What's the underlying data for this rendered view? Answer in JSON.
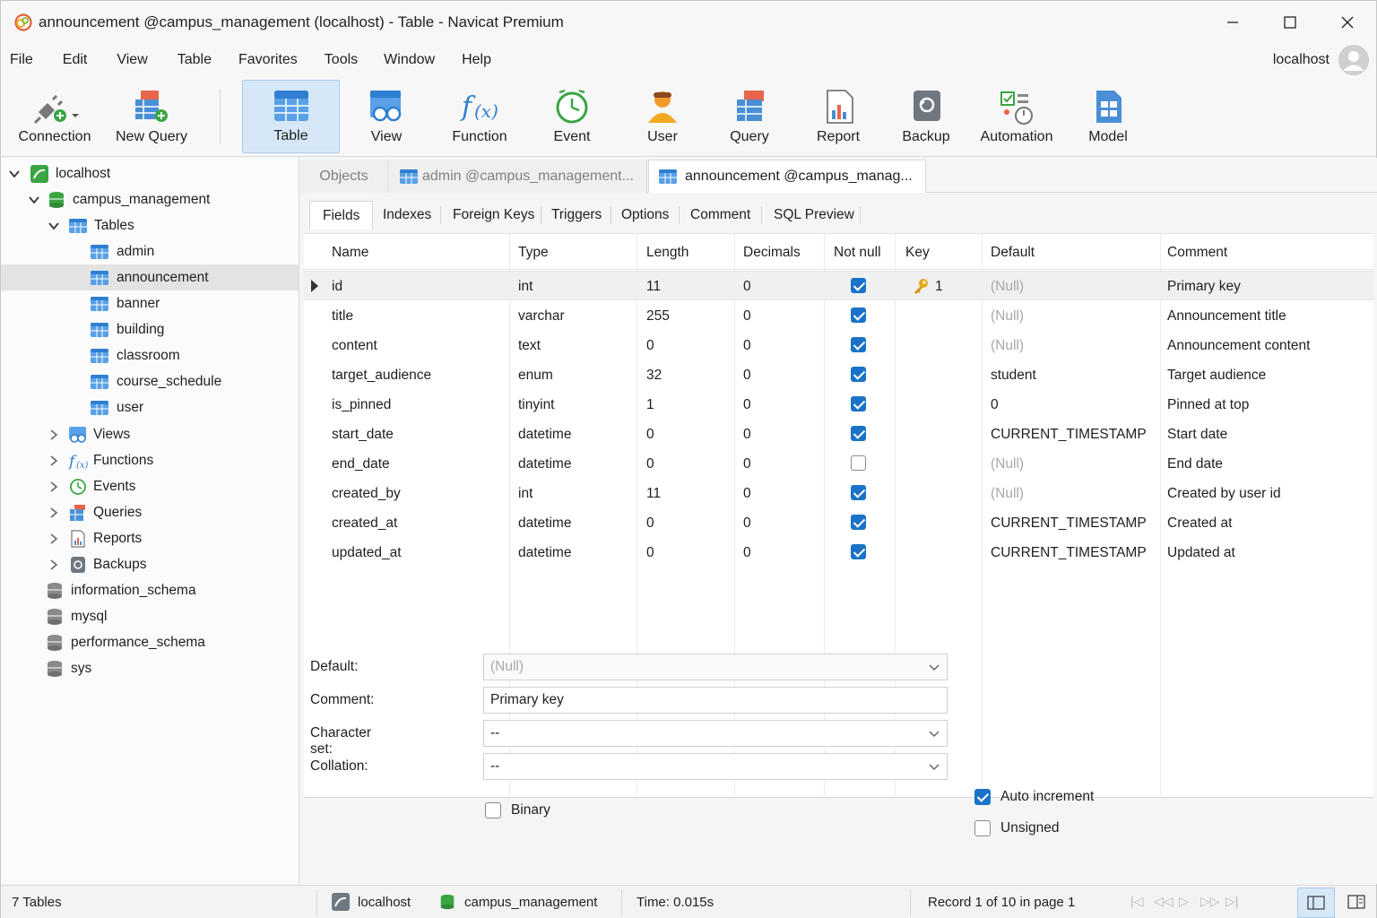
{
  "window": {
    "title": "announcement @campus_management (localhost) - Table - Navicat Premium"
  },
  "menu": [
    "File",
    "Edit",
    "View",
    "Table",
    "Favorites",
    "Tools",
    "Window",
    "Help"
  ],
  "user": {
    "name": "localhost"
  },
  "toolbar": {
    "connection": "Connection",
    "new_query": "New Query",
    "table": "Table",
    "view": "View",
    "function": "Function",
    "event": "Event",
    "user": "User",
    "query": "Query",
    "report": "Report",
    "backup": "Backup",
    "automation": "Automation",
    "model": "Model"
  },
  "sidebar": {
    "connection": "localhost",
    "database": "campus_management",
    "tables_label": "Tables",
    "tables": [
      "admin",
      "announcement",
      "banner",
      "building",
      "classroom",
      "course_schedule",
      "user"
    ],
    "selected_table": "announcement",
    "groups": [
      "Views",
      "Functions",
      "Events",
      "Queries",
      "Reports",
      "Backups"
    ],
    "other_databases": [
      "information_schema",
      "mysql",
      "performance_schema",
      "sys"
    ]
  },
  "doc_tabs": {
    "objects": "Objects",
    "tab1": "admin @campus_management...",
    "tab2": "announcement @campus_manag..."
  },
  "sub_tabs": [
    "Fields",
    "Indexes",
    "Foreign Keys",
    "Triggers",
    "Options",
    "Comment",
    "SQL Preview"
  ],
  "grid": {
    "headers": {
      "name": "Name",
      "type": "Type",
      "length": "Length",
      "decimals": "Decimals",
      "not_null": "Not null",
      "key": "Key",
      "default": "Default",
      "comment": "Comment"
    },
    "rows": [
      {
        "name": "id",
        "type": "int",
        "length": "11",
        "decimals": "0",
        "not_null": true,
        "key": "1",
        "default": "(Null)",
        "comment": "Primary key"
      },
      {
        "name": "title",
        "type": "varchar",
        "length": "255",
        "decimals": "0",
        "not_null": true,
        "key": "",
        "default": "(Null)",
        "comment": "Announcement title"
      },
      {
        "name": "content",
        "type": "text",
        "length": "0",
        "decimals": "0",
        "not_null": true,
        "key": "",
        "default": "(Null)",
        "comment": "Announcement content"
      },
      {
        "name": "target_audience",
        "type": "enum",
        "length": "32",
        "decimals": "0",
        "not_null": true,
        "key": "",
        "default": "student",
        "comment": "Target audience"
      },
      {
        "name": "is_pinned",
        "type": "tinyint",
        "length": "1",
        "decimals": "0",
        "not_null": true,
        "key": "",
        "default": "0",
        "comment": "Pinned at top"
      },
      {
        "name": "start_date",
        "type": "datetime",
        "length": "0",
        "decimals": "0",
        "not_null": true,
        "key": "",
        "default": "CURRENT_TIMESTAMP",
        "comment": "Start date"
      },
      {
        "name": "end_date",
        "type": "datetime",
        "length": "0",
        "decimals": "0",
        "not_null": false,
        "key": "",
        "default": "(Null)",
        "comment": "End date"
      },
      {
        "name": "created_by",
        "type": "int",
        "length": "11",
        "decimals": "0",
        "not_null": true,
        "key": "",
        "default": "(Null)",
        "comment": "Created by user id"
      },
      {
        "name": "created_at",
        "type": "datetime",
        "length": "0",
        "decimals": "0",
        "not_null": true,
        "key": "",
        "default": "CURRENT_TIMESTAMP",
        "comment": "Created at"
      },
      {
        "name": "updated_at",
        "type": "datetime",
        "length": "0",
        "decimals": "0",
        "not_null": true,
        "key": "",
        "default": "CURRENT_TIMESTAMP",
        "comment": "Updated at"
      }
    ]
  },
  "properties": {
    "default_label": "Default:",
    "default_value": "(Null)",
    "comment_label": "Comment:",
    "comment_value": "Primary key",
    "charset_label": "Character set:",
    "charset_value": "--",
    "collation_label": "Collation:",
    "collation_value": "--",
    "binary_label": "Binary",
    "binary_checked": false,
    "auto_increment_label": "Auto increment",
    "auto_increment_checked": true,
    "unsigned_label": "Unsigned",
    "unsigned_checked": false
  },
  "status": {
    "tables_count": "7 Tables",
    "connection": "localhost",
    "database": "campus_management",
    "time": "Time: 0.015s",
    "record": "Record 1 of 10 in page 1"
  },
  "colors": {
    "accent": "#1a73c8",
    "selection": "#d6e8f7",
    "null_text": "#a8a8a8"
  }
}
